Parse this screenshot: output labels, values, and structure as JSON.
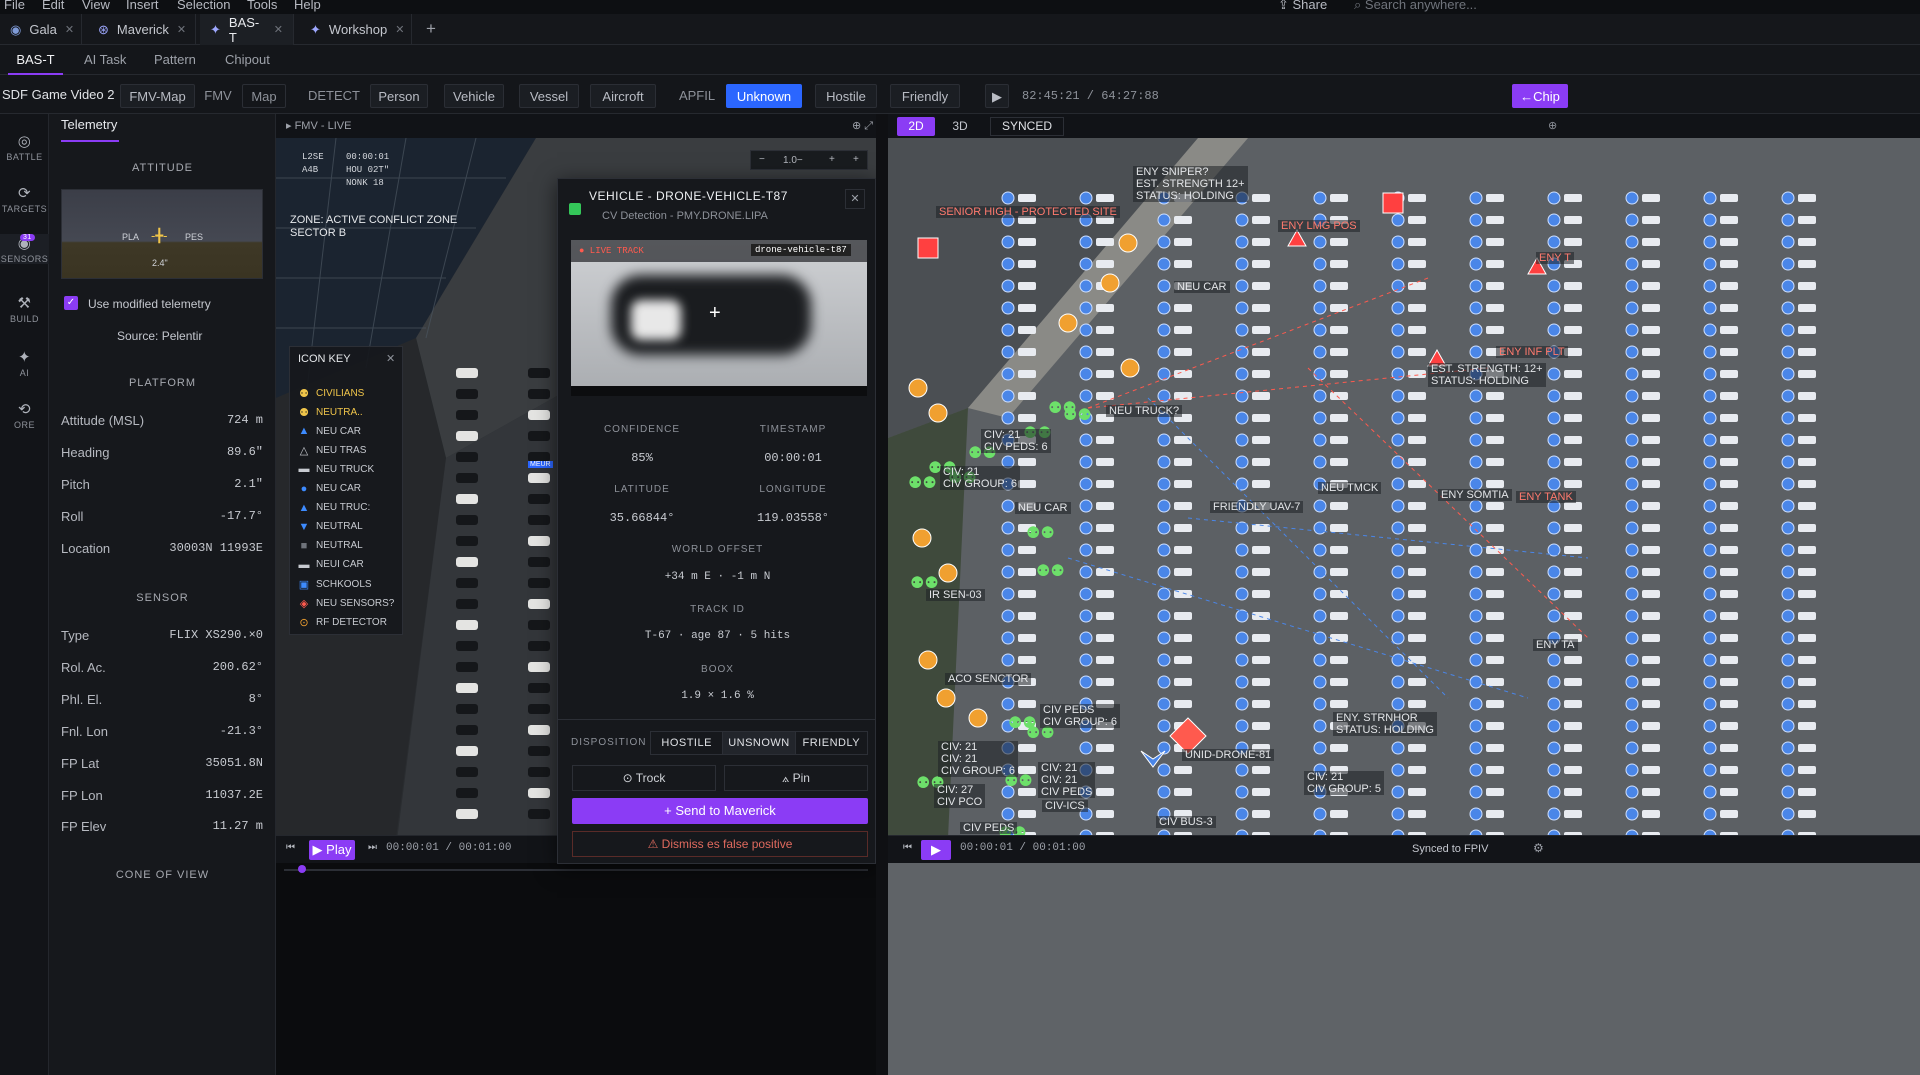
{
  "menu": [
    "File",
    "Edit",
    "View",
    "Insert",
    "Selection",
    "Tools",
    "Help"
  ],
  "top_right": {
    "share": "Share",
    "search_placeholder": "Search anywhere..."
  },
  "window_tabs": [
    {
      "label": "Gala"
    },
    {
      "label": "Maverick"
    },
    {
      "label": "BAS-T"
    },
    {
      "label": "Workshop"
    }
  ],
  "sub_tabs": [
    "BAS-T",
    "AI Task",
    "Pattern",
    "Chipout"
  ],
  "toolbar": {
    "title": "SDF Game Video 2",
    "views": [
      "FMV-Map",
      "FMV",
      "Map"
    ],
    "detect_label": "DETECT",
    "detect": [
      "Person",
      "Vehicle",
      "Vessel",
      "Aircroft"
    ],
    "apfil_label": "APFIL",
    "apfil": [
      "Unknown",
      "Hostile",
      "Friendly"
    ],
    "time": "82:45:21  /  64:27:88",
    "chip": "←Chip"
  },
  "rail": [
    {
      "label": "BATTLE"
    },
    {
      "label": "TARGETS"
    },
    {
      "label": "SENSORS",
      "badge": "31"
    },
    {
      "label": "BUILD"
    },
    {
      "label": "AI"
    },
    {
      "label": "ORE"
    }
  ],
  "telemetry": {
    "tab": "Telemetry",
    "attitude": "ATTITUDE",
    "att_left": "PLA",
    "att_right": "PES",
    "att_value": "2.4\"",
    "use_modified": "Use modified telemetry",
    "source": "Source: Pelentir",
    "platform": "PLATFORM",
    "rows": [
      {
        "k": "Attitude (MSL)",
        "v": "724  m"
      },
      {
        "k": "Heading",
        "v": "89.6\""
      },
      {
        "k": "Pitch",
        "v": "2.1\""
      },
      {
        "k": "Roll",
        "v": "-17.7°"
      },
      {
        "k": "Location",
        "v": "30003N 11993E"
      }
    ],
    "sensor": "SENSOR",
    "sensor_rows": [
      {
        "k": "Type",
        "v": "FLIX XS290.×0"
      },
      {
        "k": "Rol. Ac.",
        "v": "200.62°"
      },
      {
        "k": "Phl. El.",
        "v": "8°"
      },
      {
        "k": "Fnl. Lon",
        "v": "-21.3°"
      },
      {
        "k": "FP Lat",
        "v": "35051.8N"
      },
      {
        "k": "FP Lon",
        "v": "11037.2E"
      },
      {
        "k": "FP Elev",
        "v": "11.27  m"
      }
    ],
    "cone": "CONE OF VIEW"
  },
  "fmv": {
    "header": "FMV - LIVE",
    "zoom": "1.0",
    "hud": [
      "L2SE",
      "A4B",
      "00:00:01",
      "HOU 02T\"",
      "NONK 18"
    ],
    "zone": "ZONE: ACTIVE CONFLICT ZONE\nSECTOR B",
    "tag": "MEUR",
    "play": "Play",
    "time": "00:00:01  /  00:01:00"
  },
  "icon_key": {
    "title": "ICON KEY",
    "items": [
      {
        "label": "CIVILIANS",
        "icon": "person-icon",
        "color": "#f0c54a"
      },
      {
        "label": "NEUTRA..",
        "icon": "person-icon",
        "color": "#f0c54a"
      },
      {
        "label": "NEU CAR",
        "icon": "triangle-icon",
        "color": "#3d8bff"
      },
      {
        "label": "NEU TRAS",
        "icon": "triangle-outline-icon",
        "color": "#c7cad0"
      },
      {
        "label": "NEU TRUCK",
        "icon": "truck-icon",
        "color": "#c7cad0"
      },
      {
        "label": "NEU CAR",
        "icon": "circle-icon",
        "color": "#3d8bff"
      },
      {
        "label": "NEU TRUC:",
        "icon": "triangle-icon",
        "color": "#3d8bff"
      },
      {
        "label": "NEUTRAL",
        "icon": "down-triangle-icon",
        "color": "#3d8bff"
      },
      {
        "label": "NEUTRAL",
        "icon": "square-icon",
        "color": "#6f737b"
      },
      {
        "label": "NEUI CAR",
        "icon": "car-icon",
        "color": "#c7cad0"
      },
      {
        "label": "SCHKOOLS",
        "icon": "school-icon",
        "color": "#3d8bff"
      },
      {
        "label": "NEU SENSORS?",
        "icon": "sensor-icon",
        "color": "#ff5a4e"
      },
      {
        "label": "RF DETECTOR",
        "icon": "rf-icon",
        "color": "#f0a030"
      }
    ]
  },
  "popup": {
    "title": "VEHICLE - DRONE-VEHICLE-T87",
    "subtitle": "CV Detection - PMY.DRONE.LIPA",
    "live": "● LIVE TRACK",
    "track_name": "drone-vehicle-t87",
    "confidence_l": "CONFIDENCE",
    "confidence": "85%",
    "timestamp_l": "TIMESTAMP",
    "timestamp": "00:00:01",
    "lat_l": "LATITUDE",
    "lat": "35.66844°",
    "lon_l": "LONGITUDE",
    "lon": "119.03558°",
    "offset_l": "WORLD OFFSET",
    "offset": "+34 m E  ·  -1 m N",
    "trackid_l": "TRACK ID",
    "trackid": "T-67  ·  age 87  ·  5 hits",
    "bbox_l": "BOOX",
    "bbox": "1.9 × 1.6 %",
    "disposition": "DISPOSITION",
    "disp_buttons": [
      "HOSTILE",
      "UNSNOWN",
      "FRIENDLY"
    ],
    "track": "⊙ Trock",
    "pin": "⟑ Pin",
    "send": "+ Send to Maverick",
    "dismiss": "⚠ Dismiss es false positive"
  },
  "map": {
    "modes": [
      "2D",
      "3D"
    ],
    "synced": "SYNCED",
    "time": "00:00:01  /  00:01:00",
    "synced_to": "Synced to FPIV",
    "labels": [
      {
        "t": "SENIOR HIGH - PROTECTED SITE",
        "c": "red"
      },
      {
        "t": "ENY SNIPER?\nEST. STRENGTH 12+\nSTATUS: HOLDING",
        "c": "w"
      },
      {
        "t": "ENY LMG POS",
        "c": "red"
      },
      {
        "t": "ENY T",
        "c": "red"
      },
      {
        "t": "NEU CAR",
        "c": "w"
      },
      {
        "t": "ENY INF PLT",
        "c": "red"
      },
      {
        "t": "EST. STRENGTH: 12+\nSTATUS: HOLDING",
        "c": "w"
      },
      {
        "t": "NEU TRUCK?",
        "c": "w"
      },
      {
        "t": "CIV: 21\nCIV PEDS: 6",
        "c": "w"
      },
      {
        "t": "CIV: 21\nCIV GROUP: 6",
        "c": "w"
      },
      {
        "t": "NEU TMCK",
        "c": "w"
      },
      {
        "t": "ENY SOMTIA",
        "c": "w"
      },
      {
        "t": "ENY TANK",
        "c": "red"
      },
      {
        "t": "NEU CAR",
        "c": "w"
      },
      {
        "t": "FRIENDLY UAV-7",
        "c": "w"
      },
      {
        "t": "IR SEN-03",
        "c": "w"
      },
      {
        "t": "ACO SENCTOR",
        "c": "w"
      },
      {
        "t": "CIV PEDS\nCIV GROUP: 6",
        "c": "w"
      },
      {
        "t": "ENY. STRNHOR\nSTATUS: HOLDING",
        "c": "w"
      },
      {
        "t": "ENY TA",
        "c": "w"
      },
      {
        "t": "CIV: 21\nCIV: 21\nCIV GROUP: 6",
        "c": "w"
      },
      {
        "t": "UNID-DRONE-81",
        "c": "w"
      },
      {
        "t": "CIV: 21\nCIV: 21\nCIV PEDS",
        "c": "w"
      },
      {
        "t": "CIV: 27\nCIV PCO",
        "c": "w"
      },
      {
        "t": "CIV-ICS",
        "c": "w"
      },
      {
        "t": "CIV: 21\nCIV GROUP: 5",
        "c": "w"
      },
      {
        "t": "CIV PEDS",
        "c": "w"
      },
      {
        "t": "CIV BUS-3",
        "c": "w"
      }
    ]
  }
}
